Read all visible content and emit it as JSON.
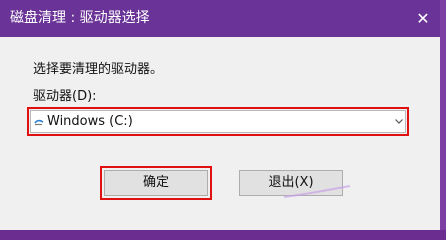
{
  "dialog": {
    "title": "磁盘清理 : 驱动器选择",
    "close_glyph": "✕",
    "prompt": "选择要清理的驱动器。",
    "drive_label": "驱动器(D):",
    "selected_drive": "Windows (C:)",
    "drive_icon": "drive-icon",
    "ok_label": "确定",
    "exit_label": "退出(X)"
  },
  "colors": {
    "titlebar": "#6a3397",
    "highlight": "#e01010",
    "background": "#f0f0f0"
  }
}
